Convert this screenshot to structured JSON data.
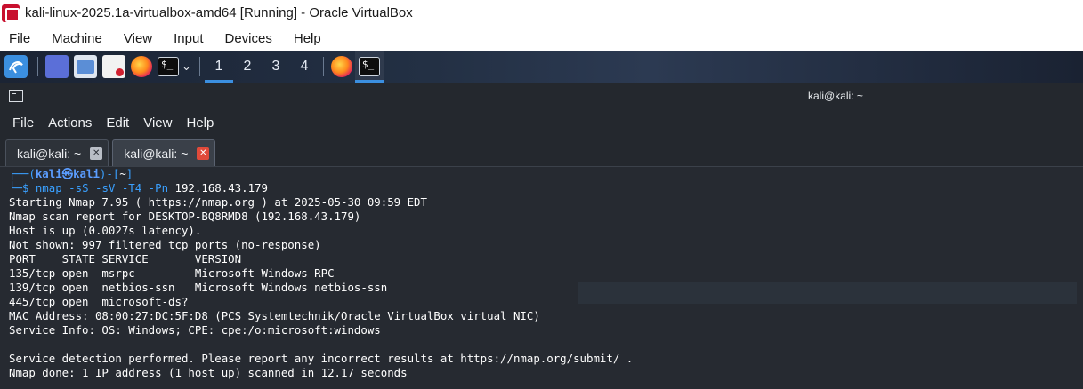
{
  "window": {
    "title": "kali-linux-2025.1a-virtualbox-amd64 [Running] - Oracle VirtualBox",
    "menu": [
      "File",
      "Machine",
      "View",
      "Input",
      "Devices",
      "Help"
    ]
  },
  "panel": {
    "workspaces": [
      "1",
      "2",
      "3",
      "4"
    ],
    "active_workspace": "1",
    "icons": [
      "kali-menu-icon",
      "desktop-icon",
      "file-manager-icon",
      "text-editor-icon",
      "firefox-icon",
      "terminal-icon"
    ]
  },
  "terminal": {
    "title": "kali@kali: ~",
    "menu": [
      "File",
      "Actions",
      "Edit",
      "View",
      "Help"
    ],
    "tabs": [
      {
        "label": "kali@kali: ~",
        "active": false
      },
      {
        "label": "kali@kali: ~",
        "active": true
      }
    ],
    "prompt": {
      "top_left": "┌──(",
      "user": "kali㉿kali",
      "mid": ")-[",
      "path": "~",
      "end": "]",
      "bottom_left": "└─",
      "dollar": "$ ",
      "command_name": "nmap",
      "command_args": " -sS -sV -T4 -Pn ",
      "command_target": "192.168.43.179"
    },
    "output": [
      "Starting Nmap 7.95 ( https://nmap.org ) at 2025-05-30 09:59 EDT",
      "Nmap scan report for DESKTOP-BQ8RMD8 (192.168.43.179)",
      "Host is up (0.0027s latency).",
      "Not shown: 997 filtered tcp ports (no-response)",
      "PORT    STATE SERVICE       VERSION",
      "135/tcp open  msrpc         Microsoft Windows RPC",
      "139/tcp open  netbios-ssn   Microsoft Windows netbios-ssn",
      "445/tcp open  microsoft-ds?",
      "MAC Address: 08:00:27:DC:5F:D8 (PCS Systemtechnik/Oracle VirtualBox virtual NIC)",
      "Service Info: OS: Windows; CPE: cpe:/o:microsoft:windows",
      "",
      "Service detection performed. Please report any incorrect results at https://nmap.org/submit/ .",
      "Nmap done: 1 IP address (1 host up) scanned in 12.17 seconds"
    ]
  }
}
